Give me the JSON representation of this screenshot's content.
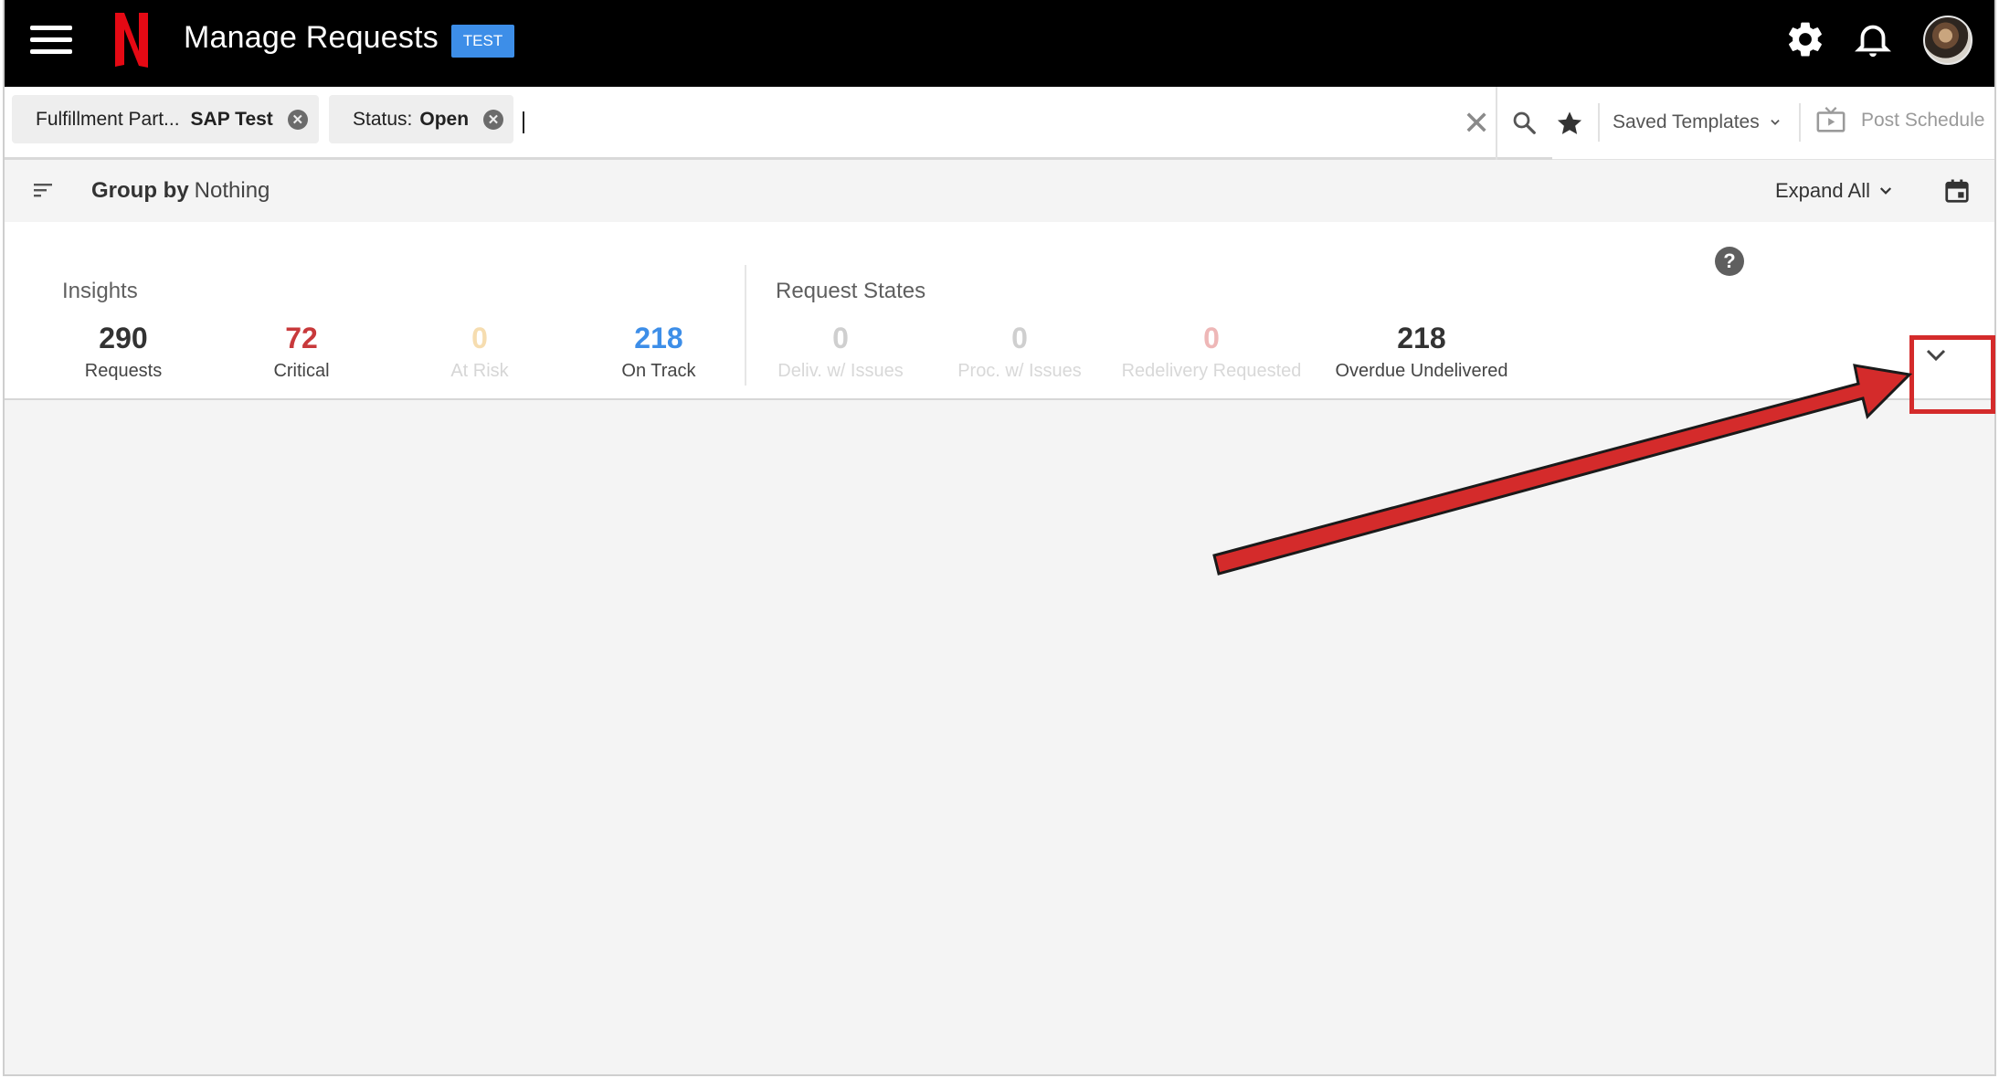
{
  "header": {
    "title": "Manage Requests",
    "env_badge": "TEST",
    "brand_color": "#e50914",
    "icons": [
      "menu-icon",
      "netflix-logo",
      "gear-icon",
      "bell-icon",
      "avatar"
    ]
  },
  "filters": {
    "chips": [
      {
        "key": "Fulfillment Part...",
        "value": "SAP Test"
      },
      {
        "key": "Status:",
        "value": "Open"
      }
    ],
    "input_value": "",
    "clear_label": "✕",
    "saved_templates_label": "Saved Templates",
    "post_schedule_label": "Post Schedule"
  },
  "groupbar": {
    "group_by_label": "Group by",
    "group_by_value": "Nothing",
    "expand_all_label": "Expand All"
  },
  "insights": {
    "title": "Insights",
    "stats": [
      {
        "value": "290",
        "label": "Requests",
        "color": "#333333",
        "label_color": "#444444"
      },
      {
        "value": "72",
        "label": "Critical",
        "color": "#c8393b",
        "label_color": "#444444"
      },
      {
        "value": "0",
        "label": "At Risk",
        "color": "#f6ddb0",
        "label_color": "#d6d6d6"
      },
      {
        "value": "218",
        "label": "On Track",
        "color": "#3d8ee8",
        "label_color": "#444444"
      }
    ]
  },
  "request_states": {
    "title": "Request States",
    "stats": [
      {
        "value": "0",
        "label": "Deliv. w/ Issues",
        "color": "#cfcfcf",
        "label_color": "#d8d8d8"
      },
      {
        "value": "0",
        "label": "Proc. w/ Issues",
        "color": "#cfcfcf",
        "label_color": "#d8d8d8"
      },
      {
        "value": "0",
        "label": "Redelivery Requested",
        "color": "#eeb7b7",
        "label_color": "#d8d8d8"
      },
      {
        "value": "218",
        "label": "Overdue Undelivered",
        "color": "#333333",
        "label_color": "#444444"
      }
    ]
  },
  "annotation": {
    "arrow_color": "#d42b2b",
    "highlight_color": "#d42b2b"
  }
}
